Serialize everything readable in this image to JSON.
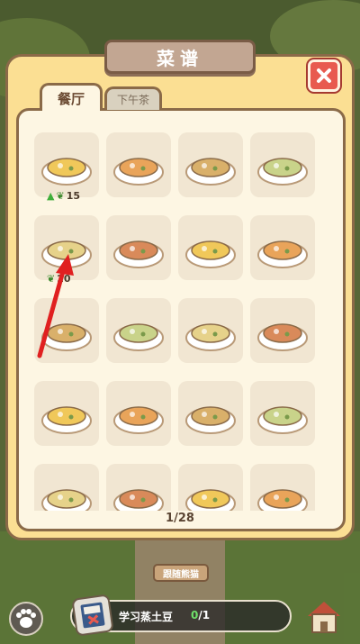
{
  "panel": {
    "title": "菜谱",
    "tabs": [
      {
        "label": "餐厅",
        "active": true
      },
      {
        "label": "下午茶",
        "active": false
      }
    ],
    "page_indicator": "1/28"
  },
  "recipes": [
    {
      "icon": "corn-soup-icon",
      "cost": "15",
      "has_upgrade": true
    },
    {
      "icon": "skewers-icon"
    },
    {
      "icon": "noodle-soup-bowl-icon"
    },
    {
      "icon": "egg-platter-icon"
    },
    {
      "icon": "potato-dish-icon",
      "cost": "20"
    },
    {
      "icon": "cat-bowl-stew-icon"
    },
    {
      "icon": "grilled-meat-plate-icon"
    },
    {
      "icon": "mixed-platter-icon"
    },
    {
      "icon": "fried-food-icon"
    },
    {
      "icon": "sandwich-icon"
    },
    {
      "icon": "curry-plate-icon"
    },
    {
      "icon": "porridge-bowl-icon"
    },
    {
      "icon": "soup-pot-icon"
    },
    {
      "icon": "rice-ball-icon"
    },
    {
      "icon": "dumplings-icon"
    },
    {
      "icon": "pudding-icon"
    },
    {
      "icon": "noodles-bowl-icon"
    },
    {
      "icon": "cake-slice-icon"
    },
    {
      "icon": "tofu-plate-icon"
    },
    {
      "icon": "blueberry-dessert-icon"
    }
  ],
  "hud": {
    "chip_label": "跟随熊猫",
    "quest_text": "学习蒸土豆",
    "quest_current": "0",
    "quest_total": "/1"
  },
  "colors": {
    "panel_bg": "#fbdf93",
    "panel_border": "#8a6a48",
    "content_bg": "#fdf6e3",
    "cell_bg": "#f1e6d2",
    "close_red": "#e85a4f",
    "title_plate": "#c2a692",
    "annotation_arrow": "#e02020",
    "quest_progress_green": "#6fe06a"
  }
}
